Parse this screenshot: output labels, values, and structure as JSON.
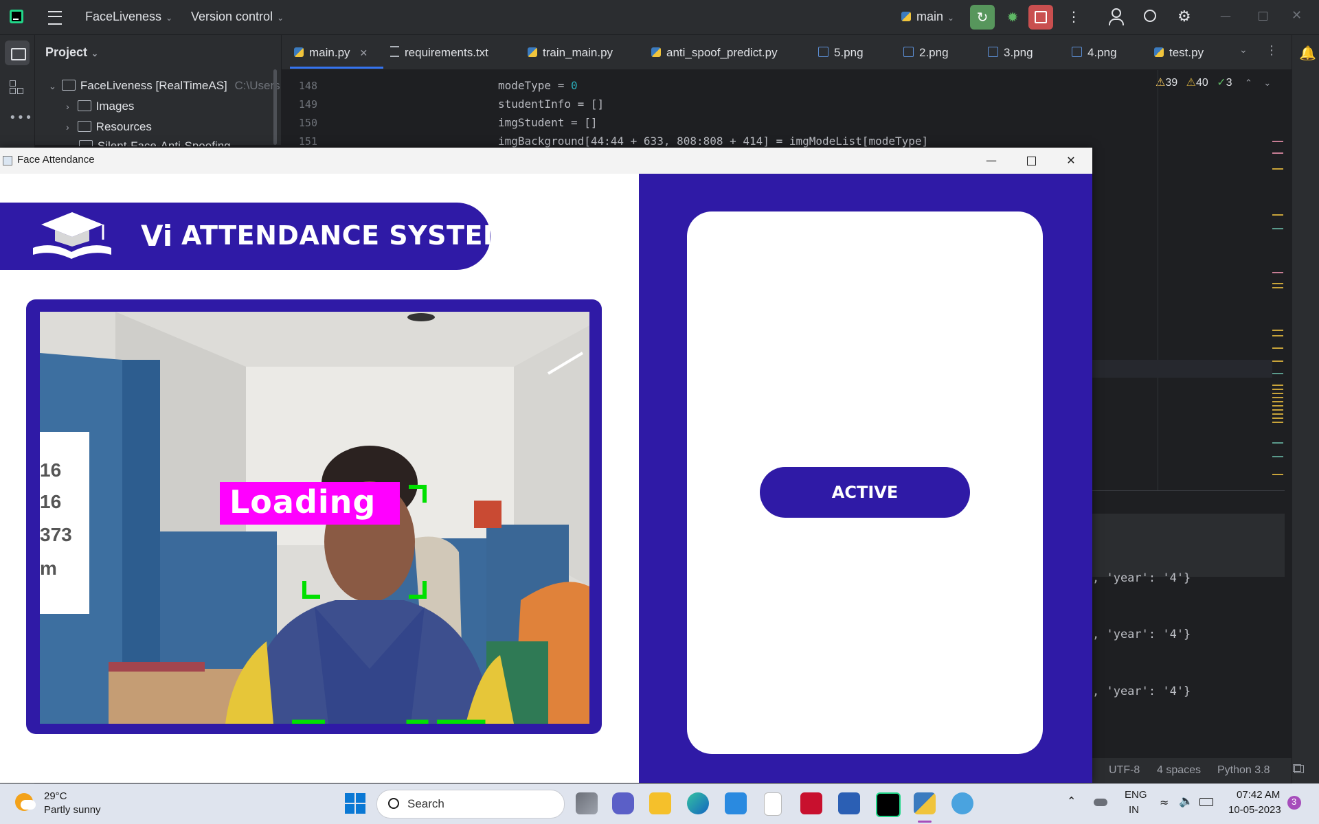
{
  "ide": {
    "project_name": "FaceLiveness",
    "version_control": "Version control",
    "branch": "main",
    "project_panel_title": "Project",
    "tree": [
      {
        "label": "FaceLiveness [RealTimeAS]",
        "hint": "C:\\Users"
      },
      {
        "label": "Images"
      },
      {
        "label": "Resources"
      },
      {
        "label": "Silent-Face-Anti-Spoofing"
      }
    ],
    "tabs": [
      {
        "label": "main.py",
        "icon": "python-file-icon",
        "active": true
      },
      {
        "label": "requirements.txt",
        "icon": "text-file-icon"
      },
      {
        "label": "train_main.py",
        "icon": "python-file-icon"
      },
      {
        "label": "anti_spoof_predict.py",
        "icon": "python-file-icon"
      },
      {
        "label": "5.png",
        "icon": "image-file-icon"
      },
      {
        "label": "2.png",
        "icon": "image-file-icon"
      },
      {
        "label": "3.png",
        "icon": "image-file-icon"
      },
      {
        "label": "4.png",
        "icon": "image-file-icon"
      },
      {
        "label": "test.py",
        "icon": "python-file-icon"
      }
    ],
    "inspections": {
      "warnings": "39",
      "weak_warnings": "40",
      "ok": "3"
    },
    "line_numbers": [
      "148",
      "149",
      "150",
      "151"
    ],
    "code": {
      "l148a": "modeType = ",
      "l148b": "0",
      "l149": "studentInfo = []",
      "l150": "imgStudent = []",
      "l151": "imgBackground[44:44 + 633, 808:808 + 414] = imgModeList[modeType]"
    },
    "terminal_lines": [
      ", 'year': '4'}",
      ", 'year': '4'}",
      ", 'year': '4'}"
    ],
    "status": {
      "encoding": "UTF-8",
      "indent": "4 spaces",
      "interpreter": "Python 3.8"
    }
  },
  "app_window": {
    "title": "Face Attendance",
    "banner_logo": "Vi",
    "banner_title": "ATTENDANCE SYSTEM",
    "loading_label": "Loading",
    "status_button": "ACTIVE",
    "colors": {
      "brand": "#2f1aa6",
      "face_box": "#00e000",
      "loading_bg": "#ff00ff"
    }
  },
  "taskbar": {
    "weather_temp": "29°C",
    "weather_desc": "Partly sunny",
    "search_placeholder": "Search",
    "lang_1": "ENG",
    "lang_2": "IN",
    "time": "07:42 AM",
    "date": "10-05-2023",
    "notification_count": "3"
  }
}
